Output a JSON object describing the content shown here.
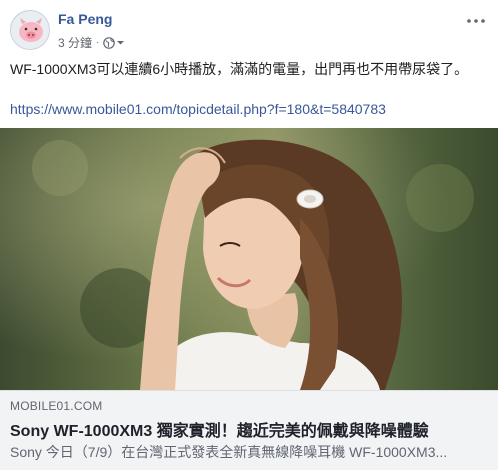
{
  "post": {
    "author": "Fa Peng",
    "time": "3 分鐘",
    "separator": "·",
    "text": "WF-1000XM3可以連續6小時播放，滿滿的電量，出門再也不用帶尿袋了。",
    "link": "https://www.mobile01.com/topicdetail.php?f=180&t=5840783"
  },
  "preview": {
    "domain": "MOBILE01.COM",
    "title": "Sony WF-1000XM3 獨家實測！趨近完美的佩戴與降噪體驗",
    "description": "Sony 今日（7/9）在台灣正式發表全新真無線降噪耳機 WF-1000XM3..."
  },
  "icons": {
    "privacy": "globe-icon",
    "privacy_menu": "caret-down-icon",
    "more": "more-dots-icon",
    "avatar": "pig-avatar"
  },
  "colors": {
    "author": "#385898",
    "link": "#385898",
    "meta": "#606770",
    "preview_bg": "#f2f3f5"
  }
}
